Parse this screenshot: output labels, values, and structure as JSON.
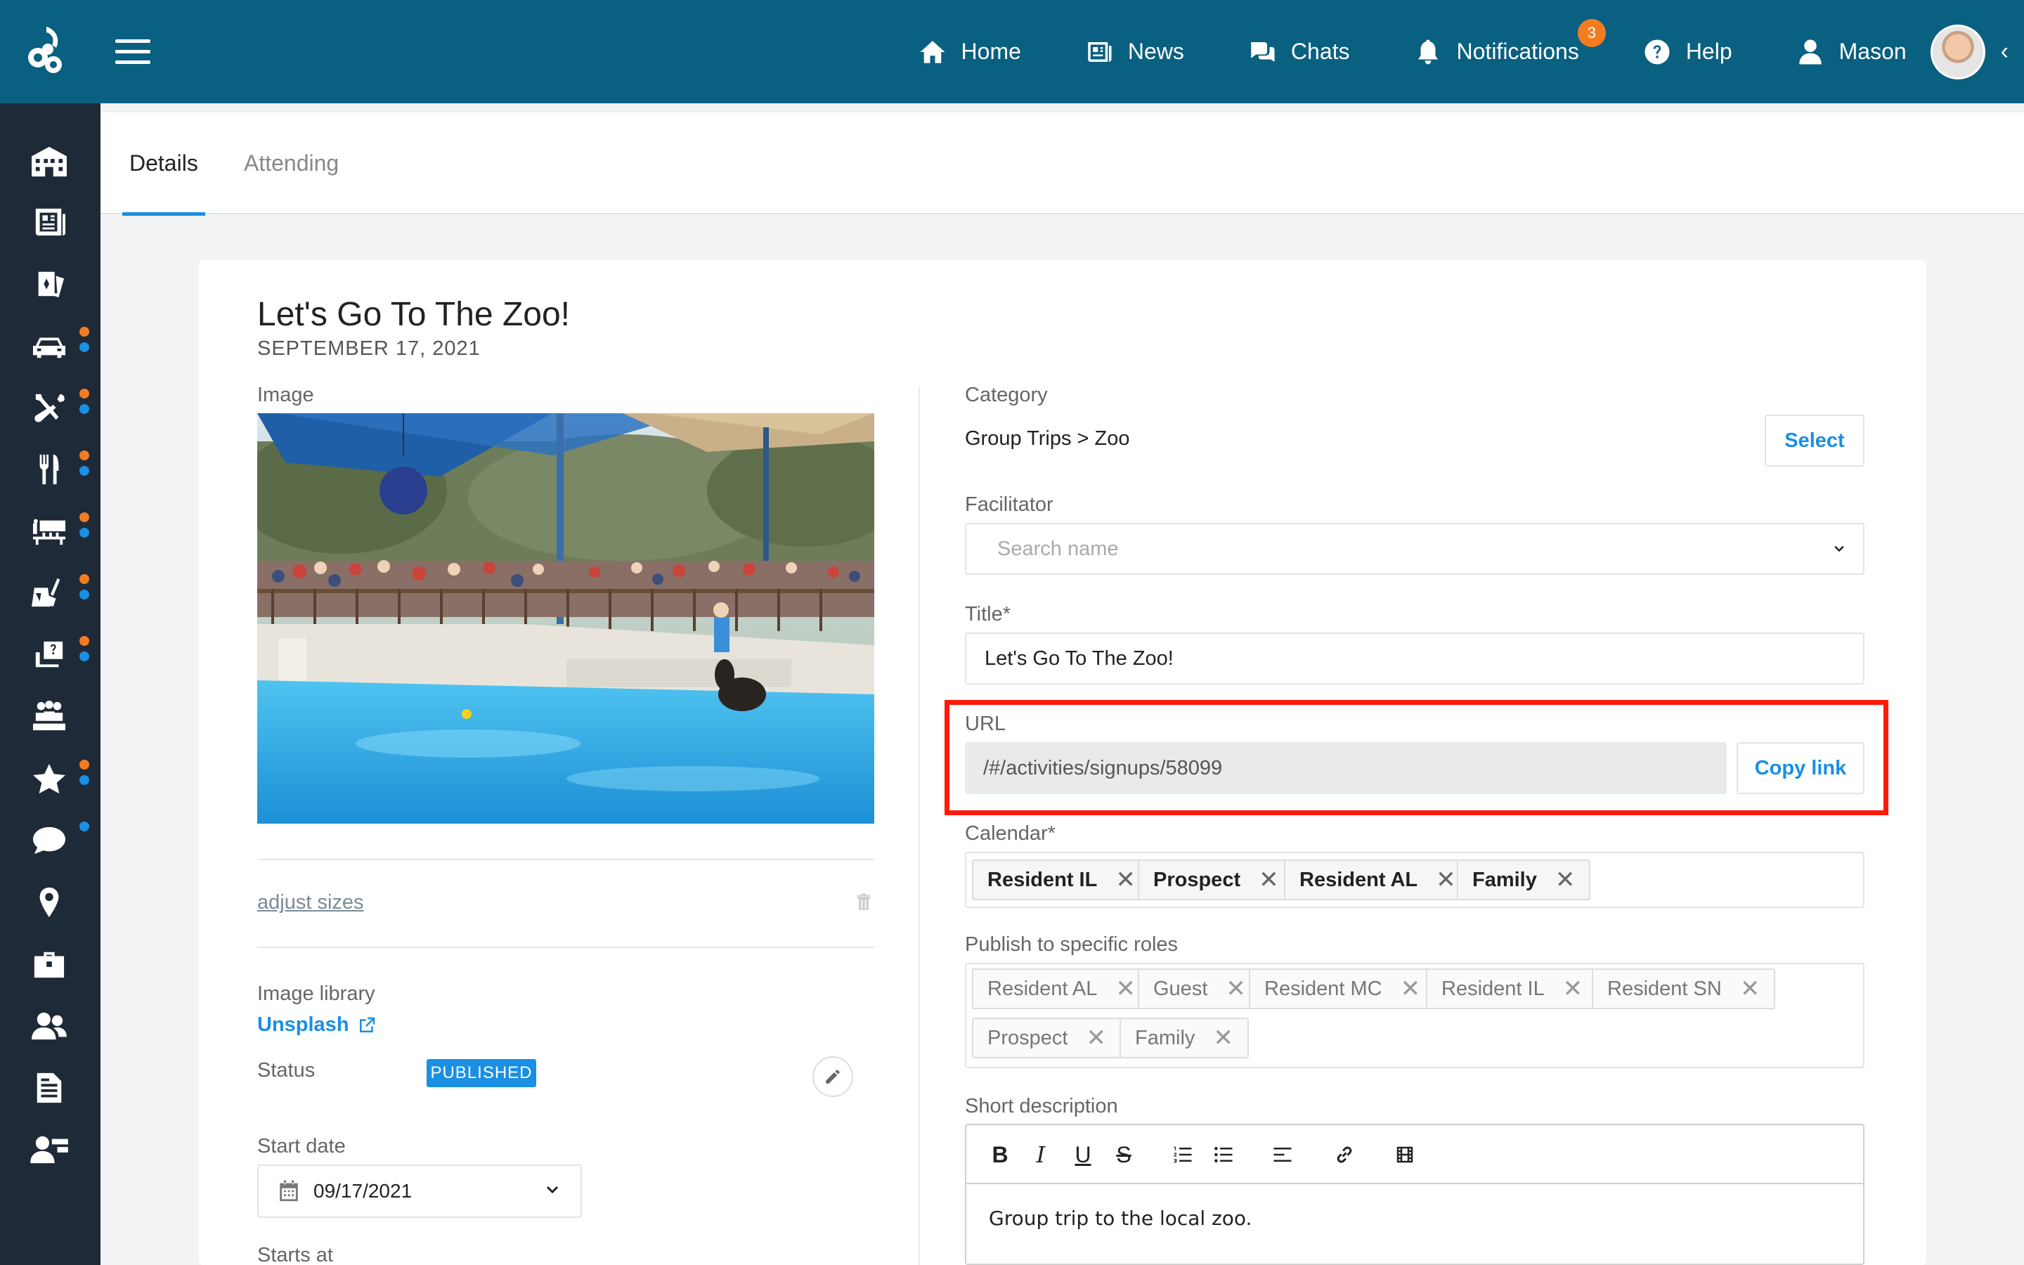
{
  "topnav": {
    "home": "Home",
    "news": "News",
    "chats": "Chats",
    "notifications": "Notifications",
    "notifications_count": "3",
    "help": "Help",
    "user": "Mason"
  },
  "sidebar": {
    "icons": [
      "building-icon",
      "newspaper-icon",
      "cards-icon",
      "car-icon",
      "tools-icon",
      "dining-icon",
      "classroom-icon",
      "housekeeping-icon",
      "support-icon",
      "community-icon",
      "star-icon",
      "chat-icon",
      "location-icon",
      "briefcase-icon",
      "people-icon",
      "document-icon",
      "user-card-icon"
    ]
  },
  "tabs": {
    "details": "Details",
    "attending": "Attending"
  },
  "event": {
    "title": "Let's Go To The Zoo!",
    "date": "SEPTEMBER 17, 2021"
  },
  "left": {
    "image_label": "Image",
    "adjust_sizes": "adjust sizes",
    "image_library_label": "Image library",
    "image_library_value": "Unsplash",
    "status_label": "Status",
    "status_value": "PUBLISHED",
    "start_date_label": "Start date",
    "start_date_value": "09/17/2021",
    "starts_at_label": "Starts at"
  },
  "right": {
    "category_label": "Category",
    "category_value": "Group Trips > Zoo",
    "select_button": "Select",
    "facilitator_label": "Facilitator",
    "facilitator_placeholder": "Search name",
    "title_label": "Title*",
    "title_value": "Let's Go To The Zoo!",
    "url_label": "URL",
    "url_value": "/#/activities/signups/58099",
    "copy_link": "Copy link",
    "calendar_label": "Calendar*",
    "calendar_tags": [
      "Resident IL",
      "Prospect",
      "Resident AL",
      "Family"
    ],
    "roles_label": "Publish to specific roles",
    "roles_tags": [
      "Resident AL",
      "Guest",
      "Resident MC",
      "Resident IL",
      "Resident SN",
      "Prospect",
      "Family"
    ],
    "short_desc_label": "Short description",
    "short_desc_value": "Group trip to the local zoo."
  },
  "colors": {
    "topbar": "#0a6080",
    "sidebar": "#1e2a38",
    "accent": "#1a8fe3",
    "badge": "#f47c20",
    "highlight": "#ff1a0a"
  }
}
